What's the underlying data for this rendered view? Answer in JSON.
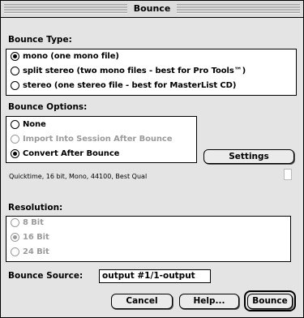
{
  "window": {
    "title": "Bounce"
  },
  "bounce_type": {
    "label": "Bounce Type:",
    "options": [
      {
        "label": "mono (one mono file)",
        "checked": true
      },
      {
        "label": "split stereo (two mono files - best for Pro Tools™)",
        "checked": false
      },
      {
        "label": "stereo (one stereo file - best for MasterList CD)",
        "checked": false
      }
    ]
  },
  "bounce_options": {
    "label": "Bounce Options:",
    "options": [
      {
        "label": "None",
        "checked": false,
        "enabled": true
      },
      {
        "label": "Import Into Session After Bounce",
        "checked": false,
        "enabled": false
      },
      {
        "label": "Convert After Bounce",
        "checked": true,
        "enabled": true
      }
    ],
    "settings_label": "Settings",
    "info": "Quicktime, 16 bit, Mono, 44100, Best Qual"
  },
  "resolution": {
    "label": "Resolution:",
    "options": [
      {
        "label": "8 Bit",
        "checked": false,
        "enabled": false
      },
      {
        "label": "16 Bit",
        "checked": true,
        "enabled": false
      },
      {
        "label": "24 Bit",
        "checked": false,
        "enabled": false
      }
    ]
  },
  "bounce_source": {
    "label": "Bounce Source:",
    "value": "output #1/1-output"
  },
  "buttons": {
    "cancel": "Cancel",
    "help": "Help...",
    "bounce": "Bounce"
  }
}
